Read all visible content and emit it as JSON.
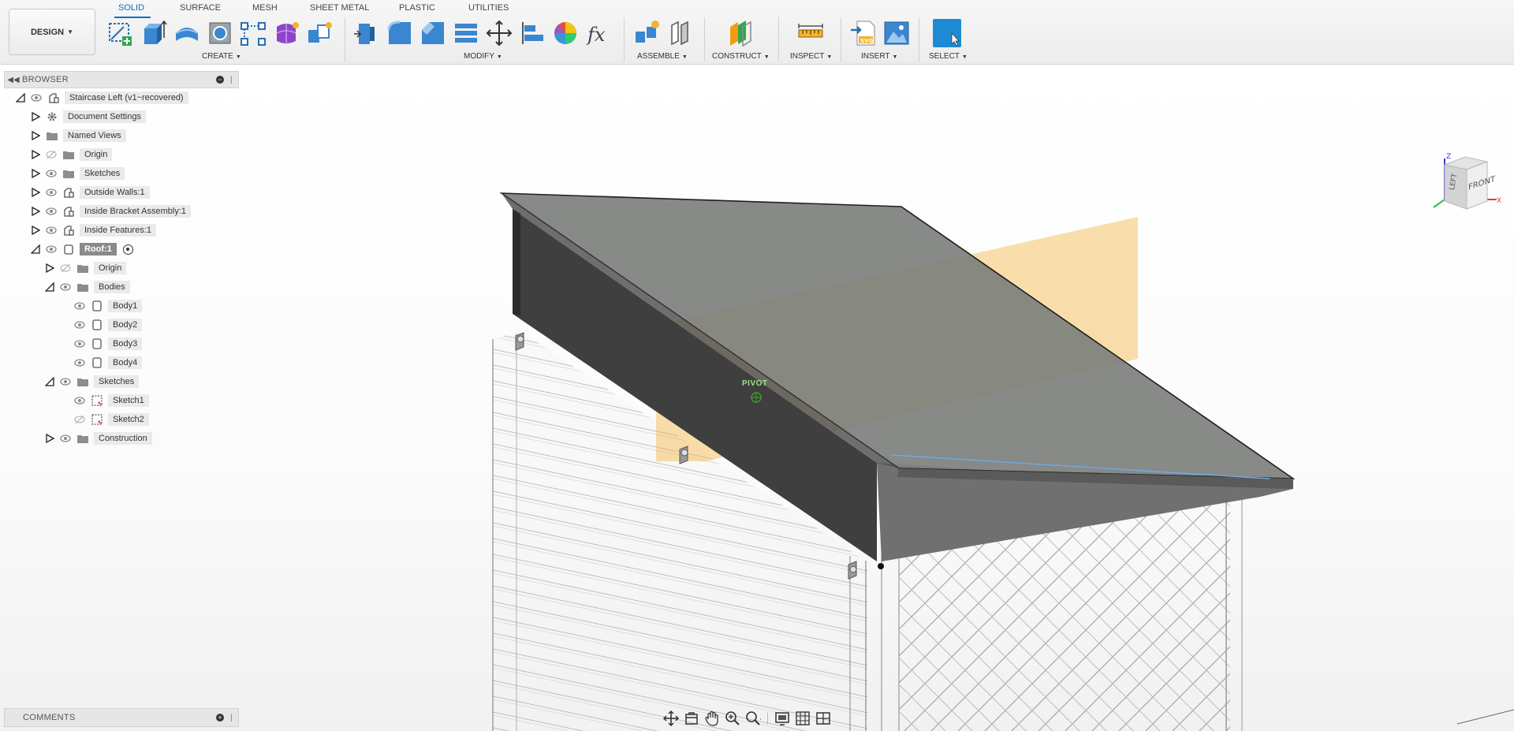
{
  "toolbar": {
    "design_label": "DESIGN",
    "tabs": [
      "SOLID",
      "SURFACE",
      "MESH",
      "SHEET METAL",
      "PLASTIC",
      "UTILITIES"
    ],
    "groups": [
      "CREATE",
      "MODIFY",
      "ASSEMBLE",
      "CONSTRUCT",
      "INSPECT",
      "INSERT",
      "SELECT"
    ],
    "accent": "#0b6fc2"
  },
  "browser": {
    "title": "BROWSER",
    "root": "Staircase Left (v1~recovered)",
    "items": [
      "Document Settings",
      "Named Views",
      "Origin",
      "Sketches",
      "Outside Walls:1",
      "Inside Bracket Assembly:1",
      "Inside Features:1",
      "Roof:1",
      "Origin",
      "Bodies",
      "Body1",
      "Body2",
      "Body3",
      "Body4",
      "Sketches",
      "Sketch1",
      "Sketch2",
      "Construction"
    ]
  },
  "comments": {
    "title": "COMMENTS"
  },
  "viewcube": {
    "front": "FRONT",
    "left": "LEFT",
    "axis_z": "Z",
    "axis_x": "X"
  },
  "viewport": {
    "pivot_label": "PIVOT"
  },
  "colors": {
    "plane": "#f5b746",
    "roof": "#5e5e5e",
    "selected_node": "#8a8a8a"
  }
}
